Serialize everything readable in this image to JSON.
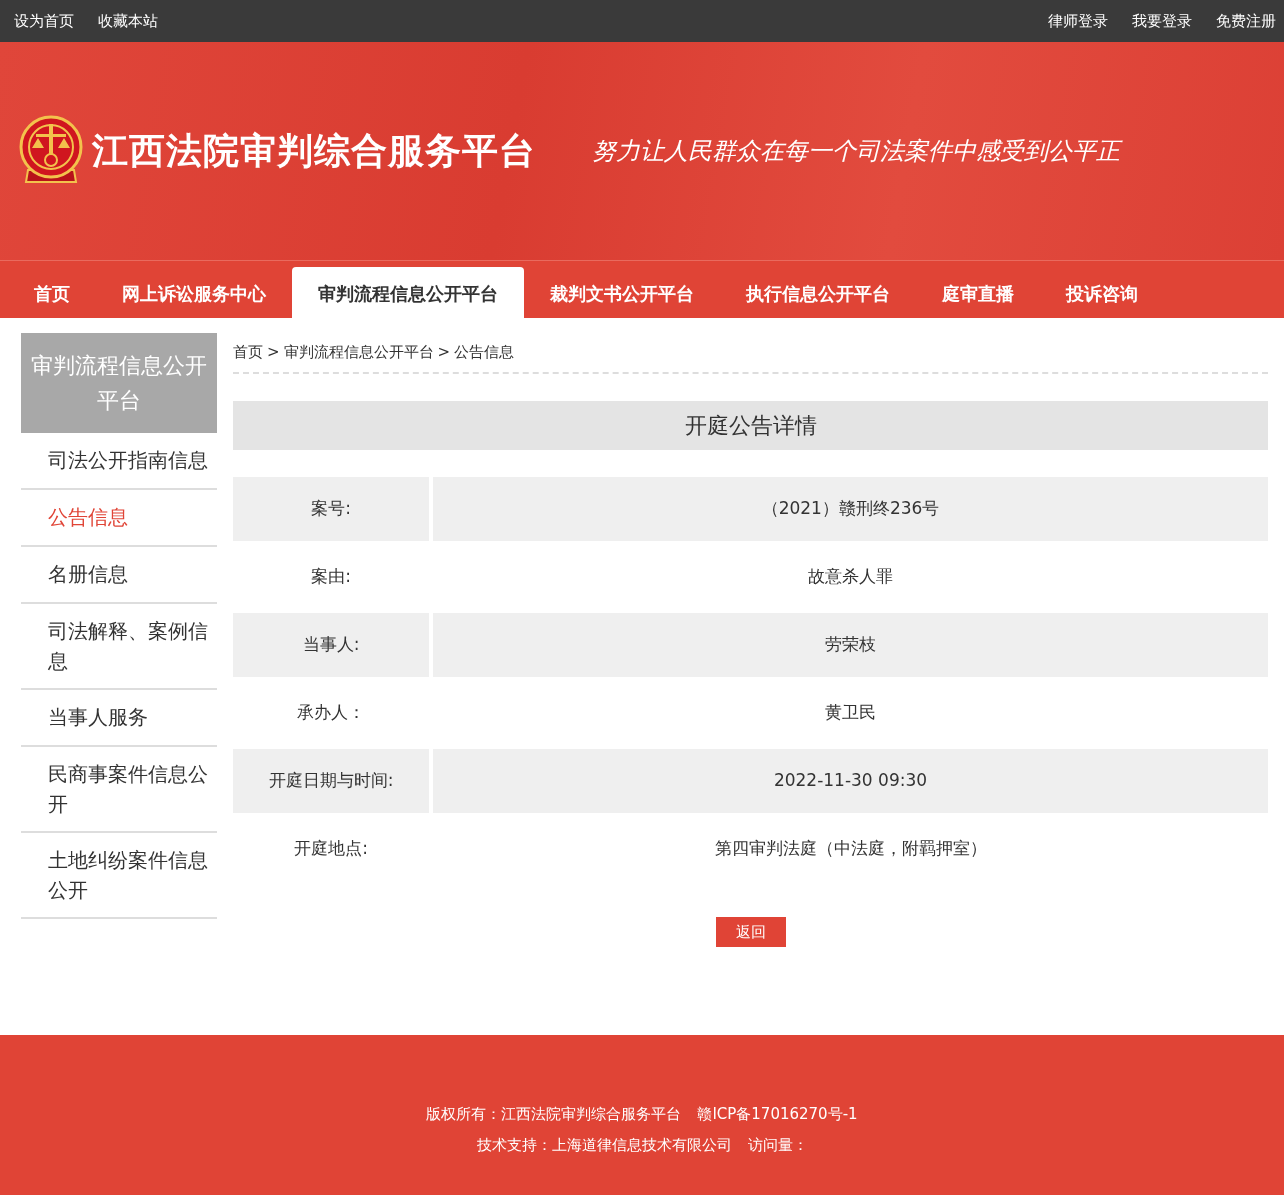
{
  "top_bar": {
    "left_links": [
      "设为首页",
      "收藏本站"
    ],
    "right_links": [
      "律师登录",
      "我要登录",
      "免费注册"
    ]
  },
  "banner": {
    "title": "江西法院审判综合服务平台",
    "slogan": "努力让人民群众在每一个司法案件中感受到公平正"
  },
  "nav": [
    {
      "label": "首页",
      "selected": false
    },
    {
      "label": "网上诉讼服务中心",
      "selected": false
    },
    {
      "label": "审判流程信息公开平台",
      "selected": true
    },
    {
      "label": "裁判文书公开平台",
      "selected": false
    },
    {
      "label": "执行信息公开平台",
      "selected": false
    },
    {
      "label": "庭审直播",
      "selected": false
    },
    {
      "label": "投诉咨询",
      "selected": false
    }
  ],
  "sidebar": {
    "title": "审判流程信息公开平台",
    "items": [
      {
        "label": "司法公开指南信息",
        "selected": false
      },
      {
        "label": "公告信息",
        "selected": true
      },
      {
        "label": "名册信息",
        "selected": false
      },
      {
        "label": "司法解释、案例信息",
        "selected": false
      },
      {
        "label": "当事人服务",
        "selected": false
      },
      {
        "label": "民商事案件信息公开",
        "selected": false
      },
      {
        "label": "土地纠纷案件信息公开",
        "selected": false
      }
    ]
  },
  "breadcrumb": {
    "separator": ">",
    "items": [
      "首页",
      "审判流程信息公开平台",
      "公告信息"
    ]
  },
  "detail": {
    "title": "开庭公告详情",
    "rows": [
      {
        "label": "案号:",
        "value": "（2021）赣刑终236号"
      },
      {
        "label": "案由:",
        "value": "故意杀人罪"
      },
      {
        "label": "当事人:",
        "value": "劳荣枝"
      },
      {
        "label": "承办人：",
        "value": "黄卫民"
      },
      {
        "label": "开庭日期与时间:",
        "value": "2022-11-30 09:30"
      },
      {
        "label": "开庭地点:",
        "value": "第四审判法庭（中法庭，附羁押室）"
      }
    ],
    "back_button": "返回"
  },
  "footer": {
    "lines": [
      [
        "版权所有：江西法院审判综合服务平台",
        "赣ICP备17016270号-1"
      ],
      [
        "技术支持：上海道律信息技术有限公司",
        "访问量："
      ]
    ]
  }
}
